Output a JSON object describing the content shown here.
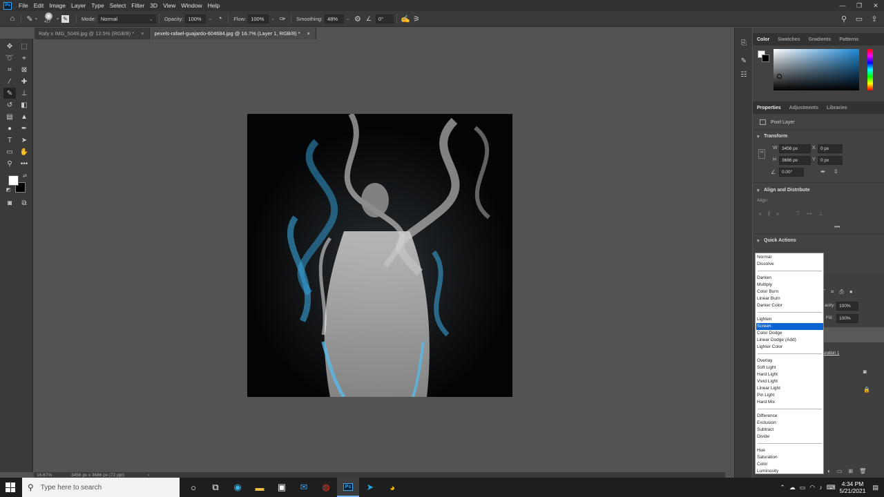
{
  "menubar": {
    "logo": "Ps",
    "items": [
      "File",
      "Edit",
      "Image",
      "Layer",
      "Type",
      "Select",
      "Filter",
      "3D",
      "View",
      "Window",
      "Help"
    ],
    "window_controls": [
      "—",
      "❐",
      "✕"
    ]
  },
  "options": {
    "brush_size": "417",
    "mode_label": "Mode:",
    "mode_value": "Normal",
    "opacity_label": "Opacity:",
    "opacity_value": "100%",
    "flow_label": "Flow:",
    "flow_value": "100%",
    "smoothing_label": "Smoothing:",
    "smoothing_value": "48%",
    "angle_value": "0°"
  },
  "tabs": [
    {
      "label": "Rafy x IMG_5049.jpg @ 12.5% (RGB/8) *",
      "close": "×"
    },
    {
      "label": "pexels-rafael-guajardo-604684.jpg @ 16.7% (Layer 1, RGB/8) *",
      "close": "×"
    }
  ],
  "status": {
    "zoom": "16.67%",
    "doc_info": "3456 px x 3686 px (72 ppi)",
    "arrow": "›"
  },
  "color_panel": {
    "tabs": [
      "Color",
      "Swatches",
      "Gradients",
      "Patterns"
    ]
  },
  "properties_panel": {
    "tabs": [
      "Properties",
      "Adjustments",
      "Libraries"
    ],
    "layer_type": "Pixel Layer",
    "transform_title": "Transform",
    "w_label": "W",
    "w_value": "3456 px",
    "h_label": "H",
    "h_value": "3686 px",
    "x_label": "X",
    "x_value": "0 px",
    "y_label": "Y",
    "y_value": "0 px",
    "angle_value": "0.00°",
    "align_title": "Align and Distribute",
    "align_label": "Align:",
    "more": "•••",
    "quick_actions_title": "Quick Actions"
  },
  "layers_partial": {
    "opacity_label": "acity:",
    "opacity_value": "100%",
    "fill_label": "Fill:",
    "fill_value": "100%",
    "layer_name_partial": "uration 1"
  },
  "blend_modes": {
    "groups": [
      [
        "Normal",
        "Dissolve"
      ],
      [
        "Darken",
        "Multiply",
        "Color Burn",
        "Linear Burn",
        "Darker Color"
      ],
      [
        "Lighten",
        "Screen",
        "Color Dodge",
        "Linear Dodge (Add)",
        "Lighter Color"
      ],
      [
        "Overlay",
        "Soft Light",
        "Hard Light",
        "Vivid Light",
        "Linear Light",
        "Pin Light",
        "Hard Mix"
      ],
      [
        "Difference",
        "Exclusion",
        "Subtract",
        "Divide"
      ],
      [
        "Hue",
        "Saturation",
        "Color",
        "Luminosity"
      ]
    ],
    "selected": "Screen"
  },
  "taskbar": {
    "search_placeholder": "Type here to search",
    "time": "4:34 PM",
    "date": "5/21/2021"
  },
  "colors": {
    "accent_selected": "#0a64d2",
    "ps_blue": "#31a8ff",
    "smoke_blue": "#2f8fc0"
  }
}
